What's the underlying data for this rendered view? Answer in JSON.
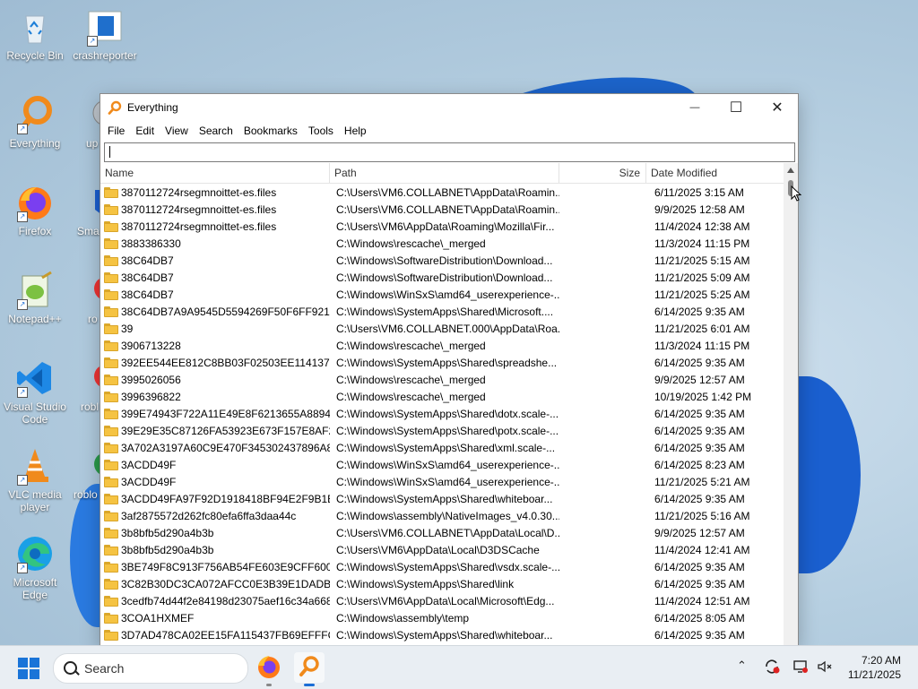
{
  "desktop": {
    "icons": [
      {
        "label": "Recycle Bin"
      },
      {
        "label": "crashreporter"
      },
      {
        "label": "Everything"
      },
      {
        "label": "up"
      },
      {
        "label": "Firefox"
      },
      {
        "label": "Sma"
      },
      {
        "label": "Notepad++"
      },
      {
        "label": "ro"
      },
      {
        "label": "Visual Studio Code"
      },
      {
        "label": "robl"
      },
      {
        "label": "VLC media player"
      },
      {
        "label": "roblo"
      },
      {
        "label": "Microsoft Edge"
      }
    ]
  },
  "window": {
    "title": "Everything",
    "controls": {
      "minimize": "—",
      "maximize": "☐",
      "close": "✕"
    },
    "menu": [
      "File",
      "Edit",
      "View",
      "Search",
      "Bookmarks",
      "Tools",
      "Help"
    ],
    "search_value": "",
    "columns": {
      "name": "Name",
      "path": "Path",
      "size": "Size",
      "date": "Date Modified"
    },
    "rows": [
      {
        "name": "3870112724rsegmnoittet-es.files",
        "path": "C:\\Users\\VM6.COLLABNET\\AppData\\Roamin...",
        "size": "",
        "date": "6/11/2025 3:15 AM"
      },
      {
        "name": "3870112724rsegmnoittet-es.files",
        "path": "C:\\Users\\VM6.COLLABNET\\AppData\\Roamin...",
        "size": "",
        "date": "9/9/2025 12:58 AM"
      },
      {
        "name": "3870112724rsegmnoittet-es.files",
        "path": "C:\\Users\\VM6\\AppData\\Roaming\\Mozilla\\Fir...",
        "size": "",
        "date": "11/4/2024 12:38 AM"
      },
      {
        "name": "3883386330",
        "path": "C:\\Windows\\rescache\\_merged",
        "size": "",
        "date": "11/3/2024 11:15 PM"
      },
      {
        "name": "38C64DB7",
        "path": "C:\\Windows\\SoftwareDistribution\\Download...",
        "size": "",
        "date": "11/21/2025 5:15 AM"
      },
      {
        "name": "38C64DB7",
        "path": "C:\\Windows\\SoftwareDistribution\\Download...",
        "size": "",
        "date": "11/21/2025 5:09 AM"
      },
      {
        "name": "38C64DB7",
        "path": "C:\\Windows\\WinSxS\\amd64_userexperience-...",
        "size": "",
        "date": "11/21/2025 5:25 AM"
      },
      {
        "name": "38C64DB7A9A9545D5594269F50F6FF92199...",
        "path": "C:\\Windows\\SystemApps\\Shared\\Microsoft....",
        "size": "",
        "date": "6/14/2025 9:35 AM"
      },
      {
        "name": "39",
        "path": "C:\\Users\\VM6.COLLABNET.000\\AppData\\Roa...",
        "size": "",
        "date": "11/21/2025 6:01 AM"
      },
      {
        "name": "3906713228",
        "path": "C:\\Windows\\rescache\\_merged",
        "size": "",
        "date": "11/3/2024 11:15 PM"
      },
      {
        "name": "392EE544EE812C8BB03F02503EE1141371FC...",
        "path": "C:\\Windows\\SystemApps\\Shared\\spreadshe...",
        "size": "",
        "date": "6/14/2025 9:35 AM"
      },
      {
        "name": "3995026056",
        "path": "C:\\Windows\\rescache\\_merged",
        "size": "",
        "date": "9/9/2025 12:57 AM"
      },
      {
        "name": "3996396822",
        "path": "C:\\Windows\\rescache\\_merged",
        "size": "",
        "date": "10/19/2025 1:42 PM"
      },
      {
        "name": "399E74943F722A11E49E8F6213655A8894EA...",
        "path": "C:\\Windows\\SystemApps\\Shared\\dotx.scale-...",
        "size": "",
        "date": "6/14/2025 9:35 AM"
      },
      {
        "name": "39E29E35C87126FA53923E673F157E8AF293...",
        "path": "C:\\Windows\\SystemApps\\Shared\\potx.scale-...",
        "size": "",
        "date": "6/14/2025 9:35 AM"
      },
      {
        "name": "3A702A3197A60C9E470F345302437896A8C...",
        "path": "C:\\Windows\\SystemApps\\Shared\\xml.scale-...",
        "size": "",
        "date": "6/14/2025 9:35 AM"
      },
      {
        "name": "3ACDD49F",
        "path": "C:\\Windows\\WinSxS\\amd64_userexperience-...",
        "size": "",
        "date": "6/14/2025 8:23 AM"
      },
      {
        "name": "3ACDD49F",
        "path": "C:\\Windows\\WinSxS\\amd64_userexperience-...",
        "size": "",
        "date": "11/21/2025 5:21 AM"
      },
      {
        "name": "3ACDD49FA97F92D1918418BF94E2F9B1E2F...",
        "path": "C:\\Windows\\SystemApps\\Shared\\whiteboar...",
        "size": "",
        "date": "6/14/2025 9:35 AM"
      },
      {
        "name": "3af2875572d262fc80efa6ffa3daa44c",
        "path": "C:\\Windows\\assembly\\NativeImages_v4.0.30...",
        "size": "",
        "date": "11/21/2025 5:16 AM"
      },
      {
        "name": "3b8bfb5d290a4b3b",
        "path": "C:\\Users\\VM6.COLLABNET\\AppData\\Local\\D...",
        "size": "",
        "date": "9/9/2025 12:57 AM"
      },
      {
        "name": "3b8bfb5d290a4b3b",
        "path": "C:\\Users\\VM6\\AppData\\Local\\D3DSCache",
        "size": "",
        "date": "11/4/2024 12:41 AM"
      },
      {
        "name": "3BE749F8C913F756AB54FE603E9CFF6003B...",
        "path": "C:\\Windows\\SystemApps\\Shared\\vsdx.scale-...",
        "size": "",
        "date": "6/14/2025 9:35 AM"
      },
      {
        "name": "3C82B30DC3CA072AFCC0E3B39E1DADBB...",
        "path": "C:\\Windows\\SystemApps\\Shared\\link",
        "size": "",
        "date": "6/14/2025 9:35 AM"
      },
      {
        "name": "3cedfb74d44f2e84198d23075aef16c34a668...",
        "path": "C:\\Users\\VM6\\AppData\\Local\\Microsoft\\Edg...",
        "size": "",
        "date": "11/4/2024 12:51 AM"
      },
      {
        "name": "3COA1HXMEF",
        "path": "C:\\Windows\\assembly\\temp",
        "size": "",
        "date": "6/14/2025 8:05 AM"
      },
      {
        "name": "3D7AD478CA02EE15FA115437FB69EFFFCC...",
        "path": "C:\\Windows\\SystemApps\\Shared\\whiteboar...",
        "size": "",
        "date": "6/14/2025 9:35 AM"
      }
    ]
  },
  "taskbar": {
    "search_label": "Search",
    "time": "7:20 AM",
    "date": "11/21/2025"
  }
}
